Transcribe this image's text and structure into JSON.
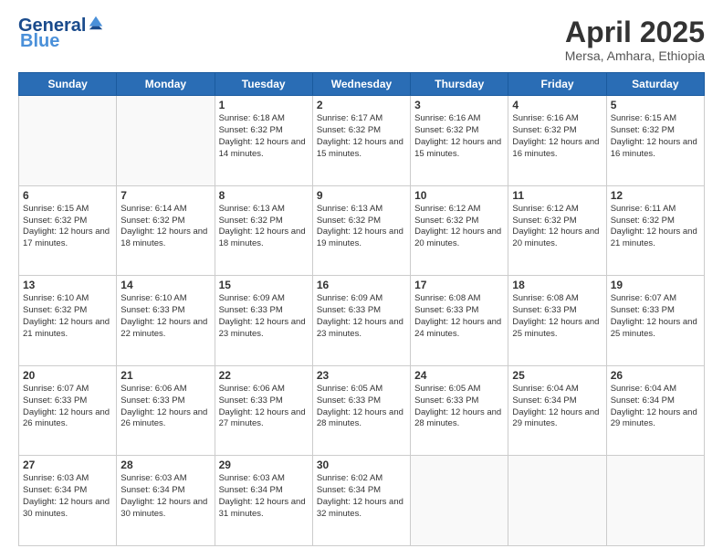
{
  "header": {
    "logo_general": "General",
    "logo_blue": "Blue",
    "title": "April 2025",
    "subtitle": "Mersa, Amhara, Ethiopia"
  },
  "weekdays": [
    "Sunday",
    "Monday",
    "Tuesday",
    "Wednesday",
    "Thursday",
    "Friday",
    "Saturday"
  ],
  "weeks": [
    [
      {
        "day": "",
        "info": ""
      },
      {
        "day": "",
        "info": ""
      },
      {
        "day": "1",
        "info": "Sunrise: 6:18 AM\nSunset: 6:32 PM\nDaylight: 12 hours and 14 minutes."
      },
      {
        "day": "2",
        "info": "Sunrise: 6:17 AM\nSunset: 6:32 PM\nDaylight: 12 hours and 15 minutes."
      },
      {
        "day": "3",
        "info": "Sunrise: 6:16 AM\nSunset: 6:32 PM\nDaylight: 12 hours and 15 minutes."
      },
      {
        "day": "4",
        "info": "Sunrise: 6:16 AM\nSunset: 6:32 PM\nDaylight: 12 hours and 16 minutes."
      },
      {
        "day": "5",
        "info": "Sunrise: 6:15 AM\nSunset: 6:32 PM\nDaylight: 12 hours and 16 minutes."
      }
    ],
    [
      {
        "day": "6",
        "info": "Sunrise: 6:15 AM\nSunset: 6:32 PM\nDaylight: 12 hours and 17 minutes."
      },
      {
        "day": "7",
        "info": "Sunrise: 6:14 AM\nSunset: 6:32 PM\nDaylight: 12 hours and 18 minutes."
      },
      {
        "day": "8",
        "info": "Sunrise: 6:13 AM\nSunset: 6:32 PM\nDaylight: 12 hours and 18 minutes."
      },
      {
        "day": "9",
        "info": "Sunrise: 6:13 AM\nSunset: 6:32 PM\nDaylight: 12 hours and 19 minutes."
      },
      {
        "day": "10",
        "info": "Sunrise: 6:12 AM\nSunset: 6:32 PM\nDaylight: 12 hours and 20 minutes."
      },
      {
        "day": "11",
        "info": "Sunrise: 6:12 AM\nSunset: 6:32 PM\nDaylight: 12 hours and 20 minutes."
      },
      {
        "day": "12",
        "info": "Sunrise: 6:11 AM\nSunset: 6:32 PM\nDaylight: 12 hours and 21 minutes."
      }
    ],
    [
      {
        "day": "13",
        "info": "Sunrise: 6:10 AM\nSunset: 6:32 PM\nDaylight: 12 hours and 21 minutes."
      },
      {
        "day": "14",
        "info": "Sunrise: 6:10 AM\nSunset: 6:33 PM\nDaylight: 12 hours and 22 minutes."
      },
      {
        "day": "15",
        "info": "Sunrise: 6:09 AM\nSunset: 6:33 PM\nDaylight: 12 hours and 23 minutes."
      },
      {
        "day": "16",
        "info": "Sunrise: 6:09 AM\nSunset: 6:33 PM\nDaylight: 12 hours and 23 minutes."
      },
      {
        "day": "17",
        "info": "Sunrise: 6:08 AM\nSunset: 6:33 PM\nDaylight: 12 hours and 24 minutes."
      },
      {
        "day": "18",
        "info": "Sunrise: 6:08 AM\nSunset: 6:33 PM\nDaylight: 12 hours and 25 minutes."
      },
      {
        "day": "19",
        "info": "Sunrise: 6:07 AM\nSunset: 6:33 PM\nDaylight: 12 hours and 25 minutes."
      }
    ],
    [
      {
        "day": "20",
        "info": "Sunrise: 6:07 AM\nSunset: 6:33 PM\nDaylight: 12 hours and 26 minutes."
      },
      {
        "day": "21",
        "info": "Sunrise: 6:06 AM\nSunset: 6:33 PM\nDaylight: 12 hours and 26 minutes."
      },
      {
        "day": "22",
        "info": "Sunrise: 6:06 AM\nSunset: 6:33 PM\nDaylight: 12 hours and 27 minutes."
      },
      {
        "day": "23",
        "info": "Sunrise: 6:05 AM\nSunset: 6:33 PM\nDaylight: 12 hours and 28 minutes."
      },
      {
        "day": "24",
        "info": "Sunrise: 6:05 AM\nSunset: 6:33 PM\nDaylight: 12 hours and 28 minutes."
      },
      {
        "day": "25",
        "info": "Sunrise: 6:04 AM\nSunset: 6:34 PM\nDaylight: 12 hours and 29 minutes."
      },
      {
        "day": "26",
        "info": "Sunrise: 6:04 AM\nSunset: 6:34 PM\nDaylight: 12 hours and 29 minutes."
      }
    ],
    [
      {
        "day": "27",
        "info": "Sunrise: 6:03 AM\nSunset: 6:34 PM\nDaylight: 12 hours and 30 minutes."
      },
      {
        "day": "28",
        "info": "Sunrise: 6:03 AM\nSunset: 6:34 PM\nDaylight: 12 hours and 30 minutes."
      },
      {
        "day": "29",
        "info": "Sunrise: 6:03 AM\nSunset: 6:34 PM\nDaylight: 12 hours and 31 minutes."
      },
      {
        "day": "30",
        "info": "Sunrise: 6:02 AM\nSunset: 6:34 PM\nDaylight: 12 hours and 32 minutes."
      },
      {
        "day": "",
        "info": ""
      },
      {
        "day": "",
        "info": ""
      },
      {
        "day": "",
        "info": ""
      }
    ]
  ]
}
